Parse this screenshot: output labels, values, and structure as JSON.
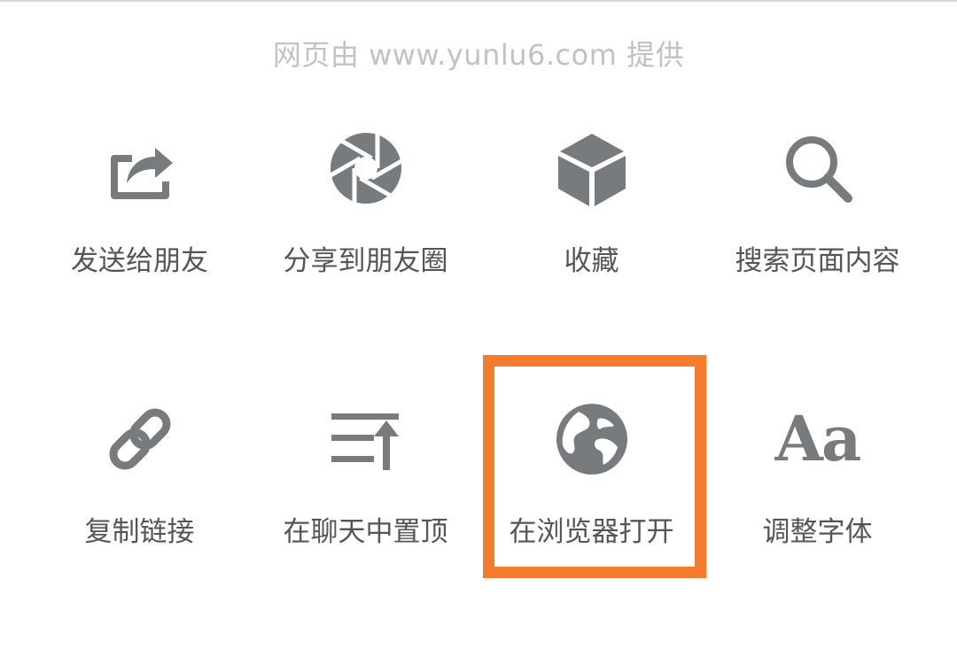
{
  "header": {
    "provider_text": "网页由 www.yunlu6.com 提供"
  },
  "actions": [
    {
      "label": "发送给朋友",
      "icon": "share-forward-icon"
    },
    {
      "label": "分享到朋友圈",
      "icon": "moments-shutter-icon"
    },
    {
      "label": "收藏",
      "icon": "favorites-cube-icon"
    },
    {
      "label": "搜索页面内容",
      "icon": "search-icon"
    },
    {
      "label": "复制链接",
      "icon": "link-icon"
    },
    {
      "label": "在聊天中置顶",
      "icon": "pin-to-top-icon"
    },
    {
      "label": "在浏览器打开",
      "icon": "globe-icon"
    },
    {
      "label": "调整字体",
      "icon": "font-size-icon",
      "glyph": "Aa"
    }
  ],
  "highlighted_action": "在浏览器打开",
  "colors": {
    "icon": "#777b7e",
    "label": "#555555",
    "provider_text": "#c2c2c2",
    "highlight_border": "#f57c2c",
    "background": "#ffffff"
  }
}
